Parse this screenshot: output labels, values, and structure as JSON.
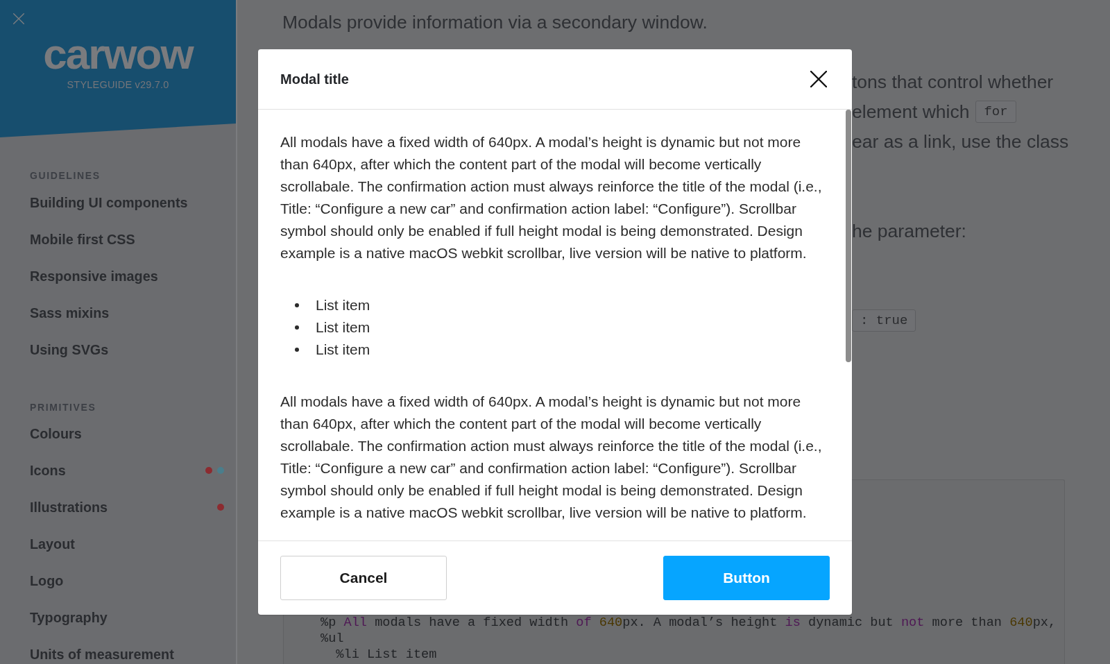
{
  "sidebar": {
    "logo": "carwow",
    "version": "STYLEGUIDE v29.7.0",
    "sections": [
      {
        "heading": "GUIDELINES",
        "items": [
          {
            "label": "Building UI components"
          },
          {
            "label": "Mobile first CSS"
          },
          {
            "label": "Responsive images"
          },
          {
            "label": "Sass mixins"
          },
          {
            "label": "Using SVGs"
          }
        ]
      },
      {
        "heading": "PRIMITIVES",
        "items": [
          {
            "label": "Colours"
          },
          {
            "label": "Icons",
            "dots": [
              {
                "color": "#8c2b30"
              },
              {
                "color": "#4a7e8c"
              }
            ]
          },
          {
            "label": "Illustrations",
            "dots": [
              {
                "color": "#8c2b30"
              }
            ]
          },
          {
            "label": "Layout"
          },
          {
            "label": "Logo"
          },
          {
            "label": "Typography"
          },
          {
            "label": "Units of measurement"
          }
        ]
      }
    ]
  },
  "page": {
    "intro": "Modals provide information via a secondary window.",
    "fragment_groups": [
      {
        "lines": [
          {
            "parts": [
              {
                "kind": "text",
                "text": "tons that control whether"
              }
            ]
          },
          {
            "parts": [
              {
                "kind": "text",
                "text": "element which"
              },
              {
                "kind": "code",
                "text": "for"
              }
            ]
          },
          {
            "parts": [
              {
                "kind": "text",
                "text": "ear as a link, use the class"
              }
            ]
          }
        ]
      },
      {
        "lines": [
          {
            "parts": [
              {
                "kind": "text",
                "text": "he parameter:"
              }
            ]
          }
        ]
      },
      {
        "lines": [
          {
            "parts": [
              {
                "kind": "code",
                "text": ": true"
              }
            ]
          }
        ]
      }
    ],
    "code_lines": [
      {
        "tokens": [
          {
            "kind": "plain",
            "text": "%p "
          },
          {
            "kind": "keyword",
            "text": "All"
          },
          {
            "kind": "plain",
            "text": " modals have a fixed width "
          },
          {
            "kind": "keyword",
            "text": "of "
          },
          {
            "kind": "number",
            "text": "640"
          },
          {
            "kind": "plain",
            "text": "px. A modal’s height "
          },
          {
            "kind": "keyword",
            "text": "is"
          },
          {
            "kind": "plain",
            "text": " dynamic but "
          },
          {
            "kind": "keyword",
            "text": "not"
          },
          {
            "kind": "plain",
            "text": " more than "
          },
          {
            "kind": "number",
            "text": "640"
          },
          {
            "kind": "plain",
            "text": "px,"
          }
        ]
      },
      {
        "tokens": [
          {
            "kind": "plain",
            "text": "%ul"
          }
        ]
      },
      {
        "tokens": [
          {
            "kind": "plain",
            "text": "  %li List item"
          }
        ]
      }
    ]
  },
  "modal": {
    "title": "Modal title",
    "body": [
      {
        "kind": "paragraph",
        "text": "All modals have a fixed width of 640px. A modal’s height is dynamic but not more than 640px, after which the content part of the modal will become vertically scrollabale. The confirmation action must always reinforce the title of the modal (i.e., Title: “Configure a new car” and confirmation action label: “Configure”). Scrollbar symbol should only be enabled if full height modal is being demonstrated. Design example is a native macOS webkit scrollbar, live version will be native to platform."
      },
      {
        "kind": "list",
        "items": [
          "List item",
          "List item",
          "List item"
        ]
      },
      {
        "kind": "paragraph",
        "text": "All modals have a fixed width of 640px. A modal’s height is dynamic but not more than 640px, after which the content part of the modal will become vertically scrollabale. The confirmation action must always reinforce the title of the modal (i.e., Title: “Configure a new car” and confirmation action label: “Configure”). Scrollbar symbol should only be enabled if full height modal is being demonstrated. Design example is a native macOS webkit scrollbar, live version will be native to platform."
      }
    ],
    "buttons": [
      {
        "kind": "secondary",
        "label": "Cancel"
      },
      {
        "kind": "primary",
        "label": "Button"
      }
    ]
  }
}
